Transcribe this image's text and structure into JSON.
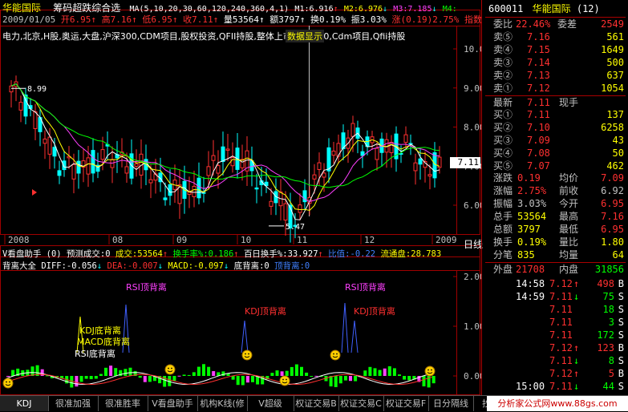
{
  "header": {
    "stock_name": "华能国际",
    "indicator_title": "筹码超跌综合选",
    "ma_label": "MA(5,10,20,30,60,120,240,360,4,1)",
    "m1": "M1:6.916",
    "m2": "M2:6.976",
    "m3": "M3:7.185",
    "m4": "M4:",
    "line2": {
      "date": "2009/01/05",
      "open": "开6.95",
      "high": "高7.16",
      "low": "低6.95",
      "close": "收7.11",
      "volume": "量53564",
      "amount": "额3797",
      "turnover": "换0.19%",
      "amplitude": "振3.03%",
      "change": "涨(0.19)2.75%",
      "extra": "指数"
    },
    "concepts": "电力,北京,H股,奥运,大盘,沪深300,CDM项目,股权投资,QFII持股,整体上市,沪深300,Cdm项目,Qfii持股",
    "popup_label": "数据显示"
  },
  "main_chart": {
    "y_labels": [
      "10.00",
      "9.00",
      "8.00",
      "7.00",
      "6.00"
    ],
    "x_labels": [
      "2008",
      "08",
      "09",
      "10",
      "11",
      "12",
      "2009"
    ],
    "period_label": "日线",
    "price_tag": "7.11",
    "annotations": {
      "high": "8.99",
      "low": "5.47"
    }
  },
  "volume_bar": {
    "title": "V看盘助手 (0)",
    "pred_vol": "预测成交:0",
    "vol": "成交:53564",
    "turnover": "换手率%:0.186",
    "hundred_day": "百日换手%:33.927",
    "ratio": "比值:-0.22",
    "float": "流通盘:28.783"
  },
  "indicator": {
    "title": "背离大全",
    "diff": "DIFF:-0.056",
    "dea": "DEA:-0.007",
    "macd": "MACD:-0.097",
    "bottom_div": "底背离:0",
    "top_div": "顶背离:0",
    "y_labels": [
      "2.00",
      "1.00",
      "0.00"
    ],
    "labels": [
      {
        "text": "RSI顶背离",
        "color": "#ff40ff"
      },
      {
        "text": "KDJ顶背离",
        "color": "#ff3030"
      },
      {
        "text": "RSI顶背离",
        "color": "#ff40ff"
      },
      {
        "text": "KDJ顶背离",
        "color": "#ff3030"
      },
      {
        "text": "KDJ底背离",
        "color": "#ffff00"
      },
      {
        "text": "MACD底背离",
        "color": "#ffff00"
      },
      {
        "text": "RSI底背离",
        "color": "#ffffff"
      }
    ]
  },
  "quote": {
    "code": "600011",
    "name": "华能国际",
    "badge": "(12)",
    "webi_label": "委比",
    "webi_value": "22.46%",
    "weicha_label": "委差",
    "weicha_value": "2549",
    "sells": [
      {
        "label": "卖⑤",
        "price": "7.16",
        "vol": "561"
      },
      {
        "label": "卖④",
        "price": "7.15",
        "vol": "1649"
      },
      {
        "label": "卖③",
        "price": "7.14",
        "vol": "500"
      },
      {
        "label": "卖②",
        "price": "7.13",
        "vol": "637"
      },
      {
        "label": "卖①",
        "price": "7.12",
        "vol": "1054"
      }
    ],
    "last_label": "最新",
    "last_price": "7.11",
    "hand_label": "现手",
    "buys": [
      {
        "label": "买①",
        "price": "7.11",
        "vol": "137"
      },
      {
        "label": "买②",
        "price": "7.10",
        "vol": "6258"
      },
      {
        "label": "买③",
        "price": "7.09",
        "vol": "43"
      },
      {
        "label": "买④",
        "price": "7.08",
        "vol": "50"
      },
      {
        "label": "买⑤",
        "price": "7.07",
        "vol": "462"
      }
    ],
    "stats": [
      {
        "l1": "涨跌",
        "v1": "0.19",
        "c1": "#ff3030",
        "l2": "均价",
        "v2": "7.09",
        "c2": "#ff3030"
      },
      {
        "l1": "涨幅",
        "v1": "2.75%",
        "c1": "#ff3030",
        "l2": "前收",
        "v2": "6.92",
        "c2": "#c0c0c0"
      },
      {
        "l1": "振幅",
        "v1": "3.03%",
        "c1": "#c0c0c0",
        "l2": "今开",
        "v2": "6.95",
        "c2": "#ff3030"
      },
      {
        "l1": "总手",
        "v1": "53564",
        "c1": "#ffff00",
        "l2": "最高",
        "v2": "7.16",
        "c2": "#ff3030"
      },
      {
        "l1": "总额",
        "v1": "3797",
        "c1": "#ffff00",
        "l2": "最低",
        "v2": "6.95",
        "c2": "#ff3030"
      },
      {
        "l1": "换手",
        "v1": "0.19%",
        "c1": "#ffff00",
        "l2": "量比",
        "v2": "1.80",
        "c2": "#ffff00"
      },
      {
        "l1": "分笔",
        "v1": "835",
        "c1": "#ffff00",
        "l2": "均量",
        "v2": "64",
        "c2": "#ffff00"
      }
    ],
    "outer_label": "外盘",
    "outer_value": "21708",
    "inner_label": "内盘",
    "inner_value": "31856",
    "ticks": [
      {
        "time": "14:58",
        "price": "7.12",
        "dir": "↑",
        "vol": "498",
        "side": "B"
      },
      {
        "time": "14:59",
        "price": "7.11",
        "dir": "↓",
        "vol": "75",
        "side": "S"
      },
      {
        "time": "",
        "price": "7.11",
        "dir": "",
        "vol": "18",
        "side": "S"
      },
      {
        "time": "",
        "price": "7.11",
        "dir": "",
        "vol": "3",
        "side": "S"
      },
      {
        "time": "",
        "price": "7.11",
        "dir": "",
        "vol": "172",
        "side": "S"
      },
      {
        "time": "",
        "price": "7.12",
        "dir": "↑",
        "vol": "123",
        "side": "B"
      },
      {
        "time": "",
        "price": "7.11",
        "dir": "↓",
        "vol": "8",
        "side": "S"
      },
      {
        "time": "",
        "price": "7.12",
        "dir": "↑",
        "vol": "5",
        "side": "B"
      },
      {
        "time": "15:00",
        "price": "7.11",
        "dir": "↓",
        "vol": "44",
        "side": "S"
      }
    ]
  },
  "tabs": [
    "KDJ",
    "很准加强",
    "很准胜率",
    "V看盘助手",
    "机构K线(修",
    "V超级MACD",
    "权证交易B",
    "权证交易C",
    "权证交易F",
    "日分隔线",
    "抄底"
  ],
  "watermark": "分析家公式网www.88gs.com",
  "colors": {
    "up": "#ff3030",
    "down": "#00ffff",
    "ma1": "#ffffff",
    "ma2": "#ffff00",
    "ma3": "#ff40ff",
    "ma4": "#00ff00",
    "frame": "#a00000"
  }
}
